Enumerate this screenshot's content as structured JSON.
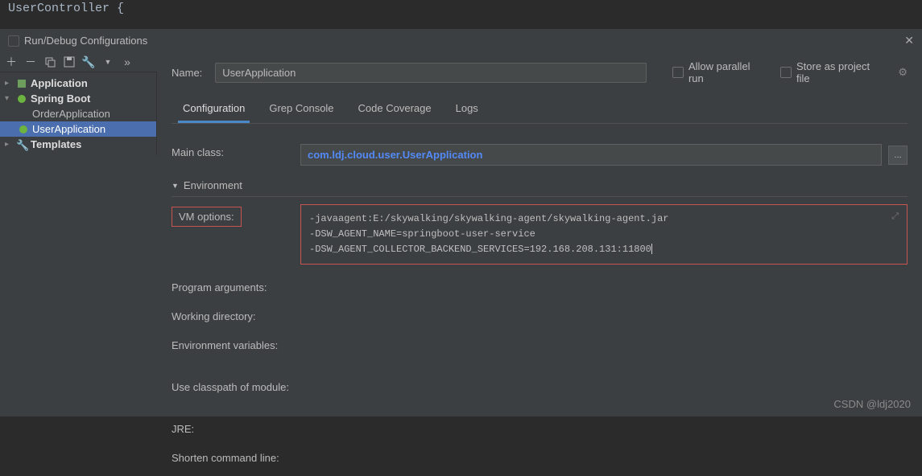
{
  "editor_snippet": {
    "line1": "UserController {"
  },
  "dialog_title": "Run/Debug Configurations",
  "name_label": "Name:",
  "name_value": "UserApplication",
  "allow_parallel": "Allow parallel run",
  "store_project": "Store as project file",
  "tree": {
    "application": "Application",
    "spring_boot": "Spring Boot",
    "order_app": "OrderApplication",
    "user_app": "UserApplication",
    "templates": "Templates"
  },
  "tabs": {
    "configuration": "Configuration",
    "grep": "Grep Console",
    "coverage": "Code Coverage",
    "logs": "Logs"
  },
  "form": {
    "main_class_label": "Main class:",
    "main_class_value": "com.ldj.cloud.user.UserApplication",
    "environment": "Environment",
    "vm_options_label": "VM options:",
    "vm_options_value": "-javaagent:E:/skywalking/skywalking-agent/skywalking-agent.jar\n-DSW_AGENT_NAME=springboot-user-service\n-DSW_AGENT_COLLECTOR_BACKEND_SERVICES=192.168.208.131:11800",
    "program_args": "Program arguments:",
    "working_dir": "Working directory:",
    "env_vars": "Environment variables:",
    "classpath": "Use classpath of module:",
    "jre": "JRE:",
    "shorten": "Shorten command line:"
  },
  "watermark": "CSDN @ldj2020",
  "browse_btn": "..."
}
